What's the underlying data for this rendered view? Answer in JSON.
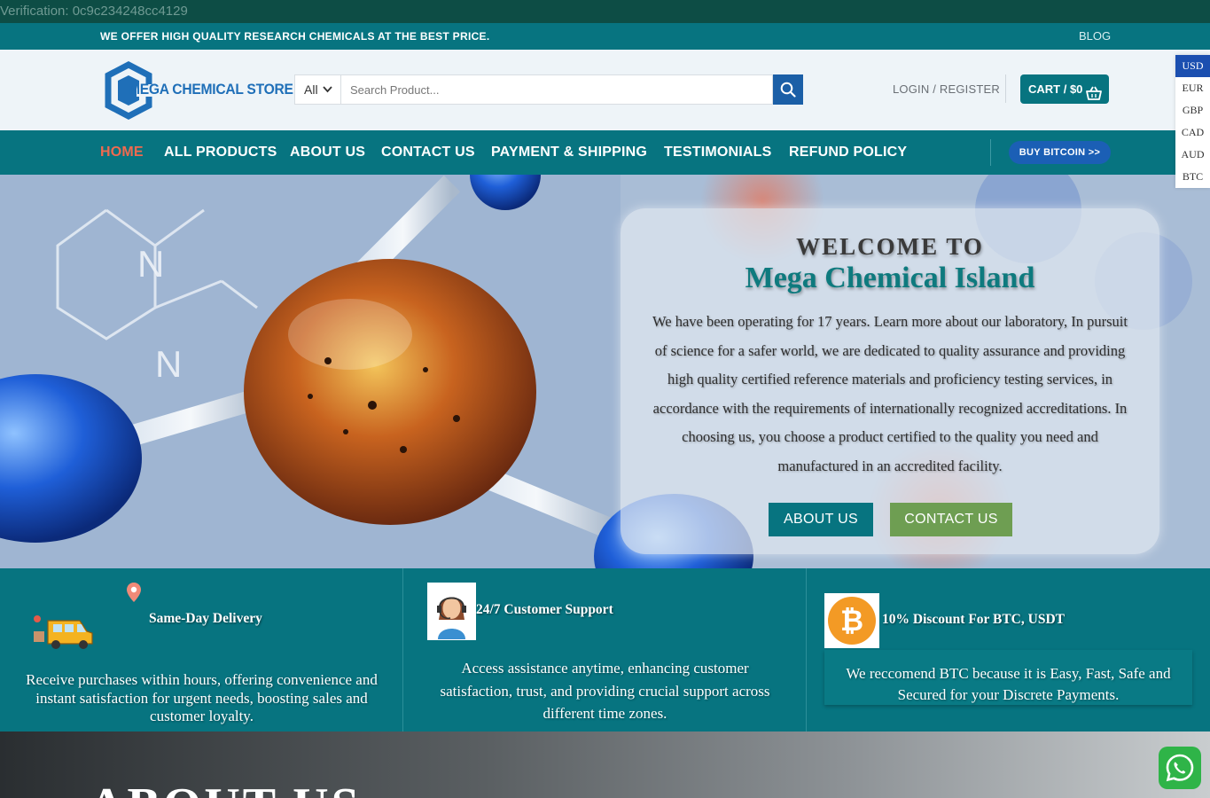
{
  "verification": "Verification: 0c9c234248cc4129",
  "topbar": {
    "promo": "WE OFFER HIGH QUALITY RESEARCH CHEMICALS AT THE BEST PRICE.",
    "blog": "BLOG"
  },
  "header": {
    "logo_text": "MEGA CHEMICAL STORE",
    "search_category": "All",
    "search_placeholder": "Search Product...",
    "login": "LOGIN / REGISTER",
    "cart": "CART / $0"
  },
  "currencies": [
    "USD",
    "EUR",
    "GBP",
    "CAD",
    "AUD",
    "BTC"
  ],
  "nav": {
    "items": [
      "HOME",
      "ALL PRODUCTS",
      "ABOUT US",
      "CONTACT US",
      "PAYMENT & SHIPPING",
      "TESTIMONIALS",
      "REFUND POLICY"
    ],
    "bitcoin_button": "BUY BITCOIN >>"
  },
  "hero": {
    "welcome": "WELCOME TO",
    "name": "Mega Chemical Island",
    "description": "We have been operating for 17 years. Learn more about our laboratory, In pursuit of science for a safer world, we are dedicated to quality assurance and providing high quality certified reference materials and proficiency testing services, in accordance with the requirements of internationally recognized accreditations. In choosing us, you choose a product certified to the quality you need and manufactured in an accredited facility.",
    "about_button": "ABOUT US",
    "contact_button": "CONTACT US"
  },
  "features": [
    {
      "title": "Same-Day Delivery",
      "text": "Receive purchases within hours, offering convenience and instant satisfaction for urgent needs, boosting sales and customer loyalty."
    },
    {
      "title": "24/7 Customer Support",
      "text": "Access assistance anytime, enhancing customer satisfaction, trust, and providing crucial support across different time zones."
    },
    {
      "title": "10% Discount For BTC, USDT",
      "text": "We reccomend BTC because it is Easy, Fast, Safe and Secured for your Discrete Payments."
    }
  ],
  "about": {
    "heading": "ABOUT US"
  },
  "colors": {
    "teal": "#077480",
    "accent_orange": "#f06a4f",
    "blue": "#1b5fa7",
    "green_button": "#6e9e52",
    "whatsapp": "#2fb448"
  }
}
